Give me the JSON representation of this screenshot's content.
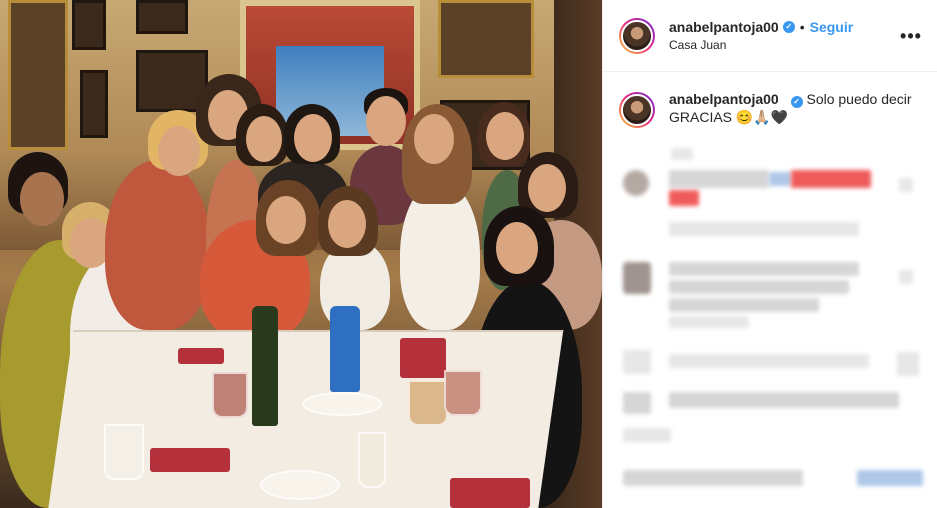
{
  "post": {
    "username": "anabelpantoja00",
    "verified_mark": "✓",
    "separator": "•",
    "follow_label": "Seguir",
    "location": "Casa Juan",
    "more_label": "•••"
  },
  "caption": {
    "username": "anabelpantoja00",
    "text": "Solo puedo decir GRACIAS 😊🙏🏼🖤"
  },
  "icons": {
    "verified": "verified-badge-icon",
    "more": "more-options-icon"
  },
  "colors": {
    "accent": "#3897f0",
    "text": "#262626",
    "border": "#efefef"
  }
}
